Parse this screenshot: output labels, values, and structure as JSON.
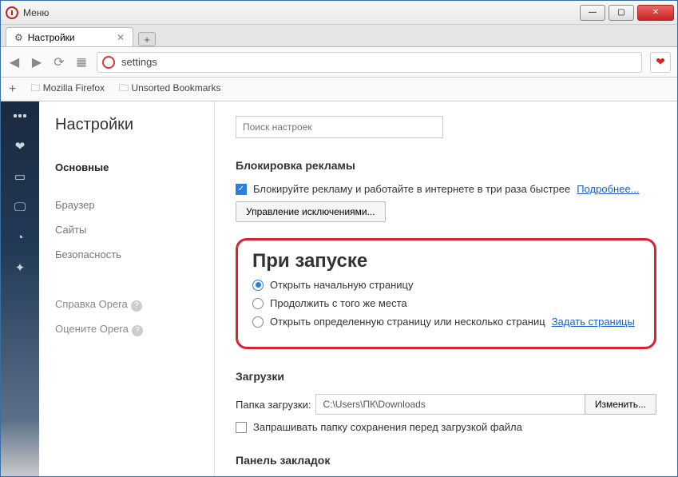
{
  "window": {
    "menu": "Меню"
  },
  "tab": {
    "title": "Настройки"
  },
  "addressbar": {
    "url": "settings"
  },
  "bookmarks_bar": {
    "folder1": "Mozilla Firefox",
    "folder2": "Unsorted Bookmarks"
  },
  "sidebar": {
    "title": "Настройки",
    "items": [
      "Основные",
      "Браузер",
      "Сайты",
      "Безопасность"
    ],
    "help": "Справка Opera",
    "rate": "Оцените Opera"
  },
  "settings": {
    "search_placeholder": "Поиск настроек",
    "adblock": {
      "title": "Блокировка рекламы",
      "checkbox": "Блокируйте рекламу и работайте в интернете в три раза быстрее",
      "more": "Подробнее...",
      "manage": "Управление исключениями..."
    },
    "startup": {
      "title": "При запуске",
      "opt1": "Открыть начальную страницу",
      "opt2": "Продолжить с того же места",
      "opt3": "Открыть определенную страницу или несколько страниц",
      "opt3_link": "Задать страницы"
    },
    "downloads": {
      "title": "Загрузки",
      "folder_label": "Папка загрузки:",
      "folder_path": "C:\\Users\\ПК\\Downloads",
      "change": "Изменить...",
      "ask": "Запрашивать папку сохранения перед загрузкой файла"
    },
    "panel": {
      "title": "Панель закладок"
    }
  }
}
